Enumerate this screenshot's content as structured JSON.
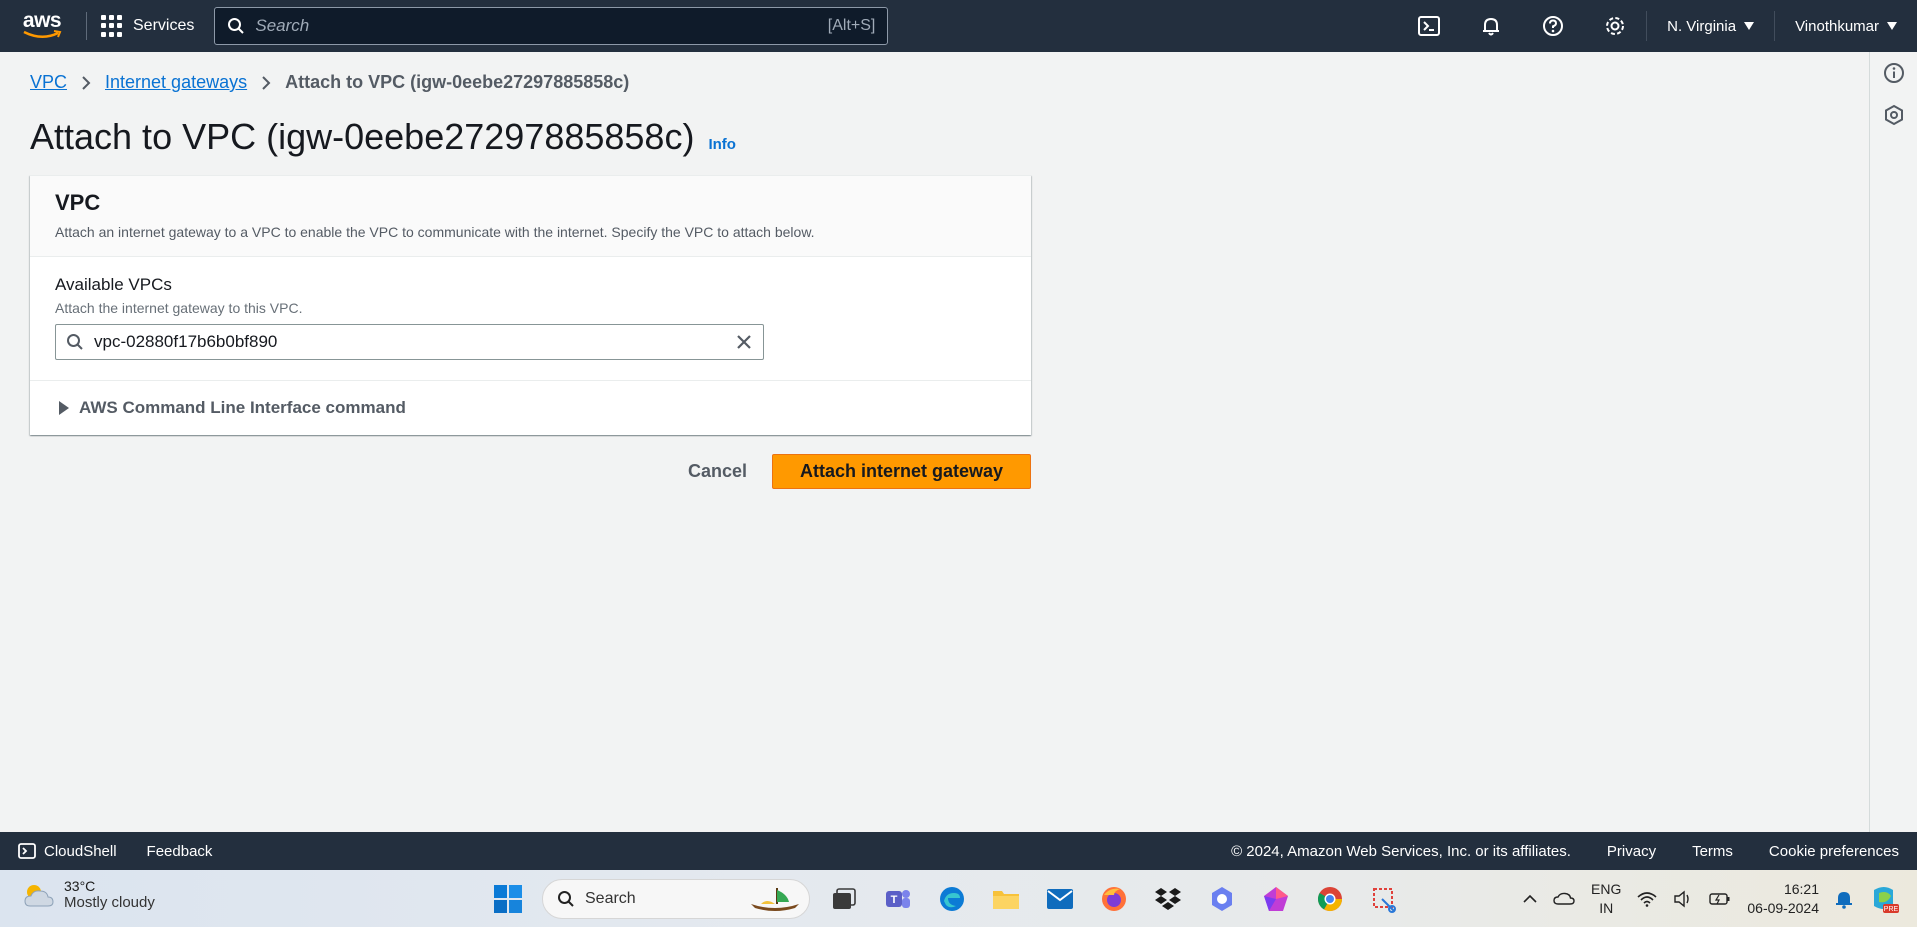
{
  "topnav": {
    "logo": "aws",
    "services_label": "Services",
    "search_placeholder": "Search",
    "search_shortcut": "[Alt+S]",
    "region": "N. Virginia",
    "user": "Vinothkumar",
    "icons": [
      "cloudshell-icon",
      "bell-icon",
      "help-icon",
      "settings-icon"
    ]
  },
  "breadcrumb": {
    "items": [
      "VPC",
      "Internet gateways"
    ],
    "current": "Attach to VPC (igw-0eebe27297885858c)"
  },
  "page": {
    "title": "Attach to VPC (igw-0eebe27297885858c)",
    "info": "Info"
  },
  "panel": {
    "title": "VPC",
    "description": "Attach an internet gateway to a VPC to enable the VPC to communicate with the internet. Specify the VPC to attach below.",
    "field_label": "Available VPCs",
    "field_desc": "Attach the internet gateway to this VPC.",
    "field_value": "vpc-02880f17b6b0bf890",
    "cli_label": "AWS Command Line Interface command"
  },
  "actions": {
    "cancel": "Cancel",
    "primary": "Attach internet gateway"
  },
  "footer": {
    "cloudshell": "CloudShell",
    "feedback": "Feedback",
    "copyright": "© 2024, Amazon Web Services, Inc. or its affiliates.",
    "privacy": "Privacy",
    "terms": "Terms",
    "cookie": "Cookie preferences"
  },
  "taskbar": {
    "temp": "33°C",
    "weather": "Mostly cloudy",
    "search": "Search",
    "lang1": "ENG",
    "lang2": "IN",
    "time": "16:21",
    "date": "06-09-2024"
  },
  "colors": {
    "nav_bg": "#232f3e",
    "primary_button": "#ff9900",
    "link": "#0972d3"
  }
}
